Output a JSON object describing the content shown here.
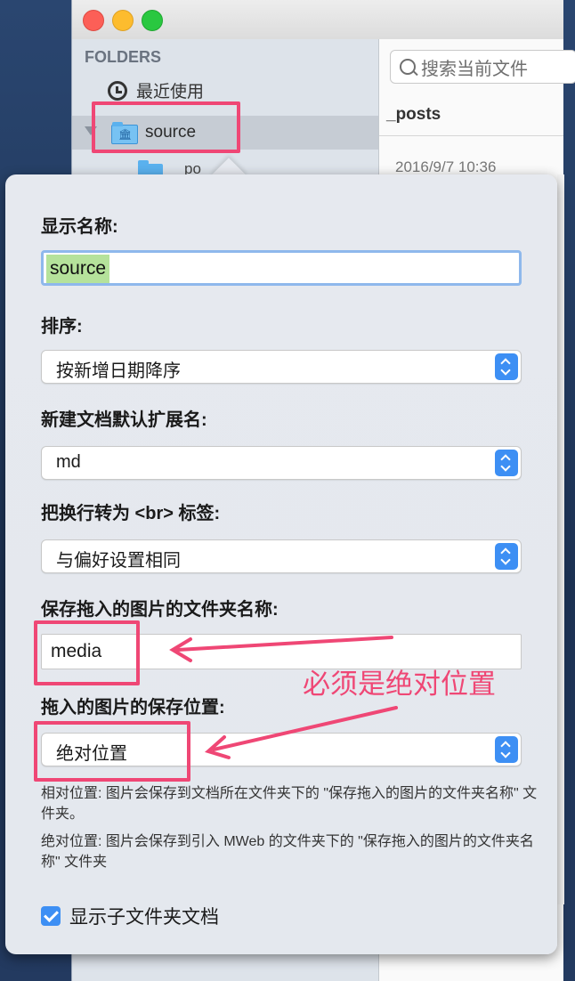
{
  "sidebar": {
    "heading": "FOLDERS",
    "recent_label": "最近使用",
    "source_label": "source",
    "posts_partial": "po"
  },
  "content": {
    "search_placeholder": "搜索当前文件",
    "header_title": "_posts",
    "date_partial": "2016/9/7 10:36"
  },
  "popover": {
    "display_name_label": "显示名称:",
    "display_name_value": "source",
    "sort_label": "排序:",
    "sort_value": "按新增日期降序",
    "ext_label": "新建文档默认扩展名:",
    "ext_value": "md",
    "br_label": "把换行转为 <br> 标签:",
    "br_value": "与偏好设置相同",
    "image_folder_label": "保存拖入的图片的文件夹名称:",
    "image_folder_value": "media",
    "image_location_label": "拖入的图片的保存位置:",
    "image_location_value": "绝对位置",
    "help_relative": "相对位置: 图片会保存到文档所在文件夹下的 \"保存拖入的图片的文件夹名称\" 文件夹。",
    "help_absolute": "绝对位置: 图片会保存到引入 MWeb 的文件夹下的 \"保存拖入的图片的文件夹名称\" 文件夹",
    "show_subfolder_docs_label": "显示子文件夹文档",
    "show_subfolder_docs_checked": true
  },
  "annotation": {
    "text": "必须是绝对位置",
    "color": "#ef4775"
  }
}
